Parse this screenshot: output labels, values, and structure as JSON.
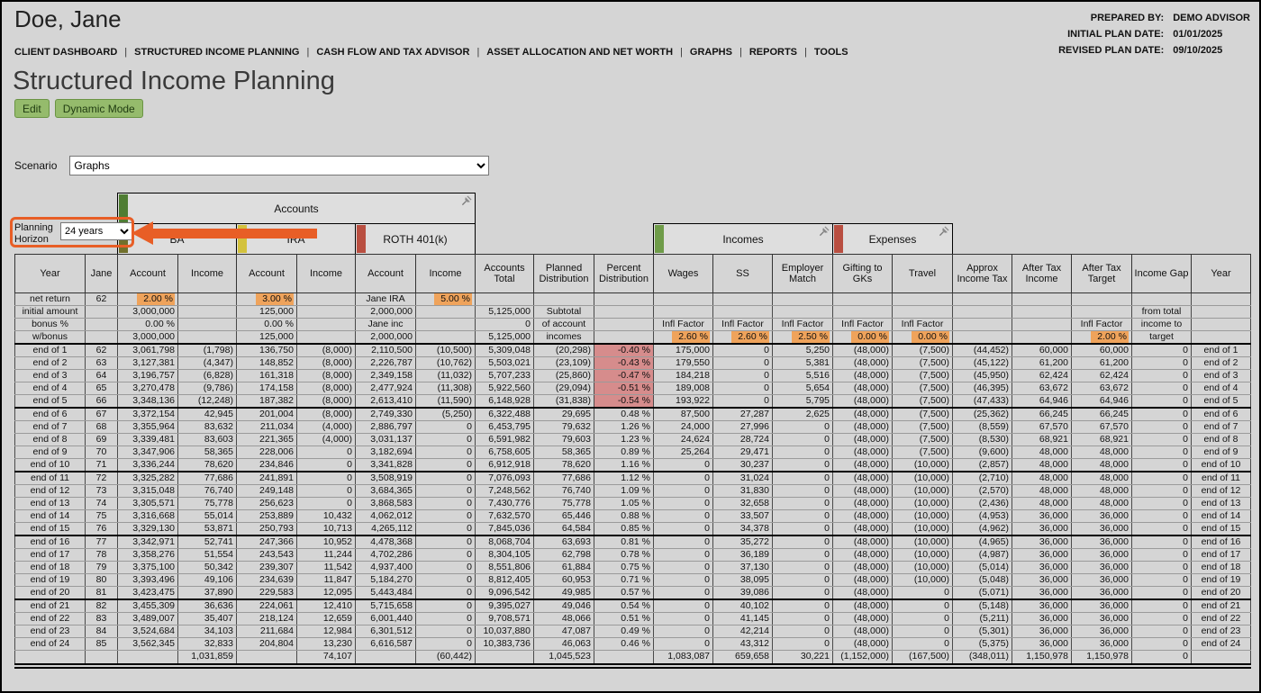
{
  "window": {
    "client_name": "Doe, Jane",
    "meta": [
      {
        "label": "PREPARED BY:",
        "value": "DEMO ADVISOR"
      },
      {
        "label": "INITIAL PLAN DATE:",
        "value": "01/01/2025"
      },
      {
        "label": "REVISED PLAN DATE:",
        "value": "09/10/2025"
      }
    ]
  },
  "nav": {
    "separator": "|",
    "items": [
      "CLIENT DASHBOARD",
      "STRUCTURED INCOME PLANNING",
      "CASH FLOW AND TAX ADVISOR",
      "ASSET ALLOCATION AND NET WORTH",
      "GRAPHS",
      "REPORTS",
      "TOOLS"
    ]
  },
  "page": {
    "title": "Structured Income Planning",
    "buttons": {
      "edit": "Edit",
      "dynamic_mode": "Dynamic Mode"
    }
  },
  "scenario": {
    "label": "Scenario",
    "value": "Graphs"
  },
  "planning_horizon": {
    "label": "Planning Horizon",
    "value": "24 years"
  },
  "colors": {
    "highlight_orange": "#efa35b",
    "highlight_red": "#d68c8c",
    "button_green": "#95bb6c",
    "button_green_border": "#6a9444",
    "annotation_orange": "#e85e26"
  },
  "groups": {
    "accounts": {
      "label": "Accounts",
      "color": "#4f7d33"
    },
    "ba": {
      "label": "BA",
      "color": "#71702c"
    },
    "ira": {
      "label": "IRA",
      "color": "#d3c23d"
    },
    "roth": {
      "label": "ROTH 401(k)",
      "color": "#b94f41"
    },
    "incomes": {
      "label": "Incomes",
      "color": "#6f9c49"
    },
    "expenses": {
      "label": "Expenses",
      "color": "#b94f41"
    }
  },
  "table": {
    "columns": [
      "Year",
      "Jane",
      "Account",
      "Income",
      "Account",
      "Income",
      "Account",
      "Income",
      "Accounts Total",
      "Planned Distribution",
      "Percent Distribution",
      "Wages",
      "SS",
      "Employer Match",
      "Gifting to GKs",
      "Travel",
      "Approx Income Tax",
      "After Tax Income",
      "After Tax Target",
      "Income Gap",
      "Year"
    ],
    "special_rows": [
      {
        "cells": [
          "net return",
          "62",
          {
            "t": "2.00 %",
            "hl": "o"
          },
          "",
          {
            "t": "3.00 %",
            "hl": "o"
          },
          "",
          {
            "t": "Jane IRA",
            "al": "c"
          },
          {
            "t": "5.00 %",
            "hl": "o"
          },
          "",
          "",
          "",
          "",
          "",
          "",
          "",
          "",
          "",
          "",
          "",
          "",
          ""
        ]
      },
      {
        "cells": [
          "initial amount",
          "",
          "3,000,000",
          "",
          "125,000",
          "",
          "2,000,000",
          "",
          "5,125,000",
          {
            "t": "Subtotal",
            "al": "c"
          },
          "",
          "",
          "",
          "",
          "",
          "",
          "",
          "",
          "",
          {
            "t": "from total",
            "al": "c"
          },
          ""
        ]
      },
      {
        "cells": [
          "bonus %",
          "",
          "0.00 %",
          "",
          "0.00 %",
          "",
          {
            "t": "Jane inc",
            "al": "c"
          },
          "",
          "0",
          {
            "t": "of account",
            "al": "c"
          },
          "",
          {
            "t": "Infl Factor",
            "al": "c"
          },
          {
            "t": "Infl Factor",
            "al": "c"
          },
          {
            "t": "Infl Factor",
            "al": "c"
          },
          {
            "t": "Infl Factor",
            "al": "c"
          },
          {
            "t": "Infl Factor",
            "al": "c"
          },
          "",
          "",
          {
            "t": "Infl Factor",
            "al": "c"
          },
          {
            "t": "income to",
            "al": "c"
          },
          ""
        ]
      },
      {
        "cells": [
          "w/bonus",
          "",
          "3,000,000",
          "",
          "125,000",
          "",
          "2,000,000",
          "",
          "5,125,000",
          {
            "t": "incomes",
            "al": "c"
          },
          "",
          {
            "t": "2.60 %",
            "hl": "o"
          },
          {
            "t": "2.60 %",
            "hl": "o"
          },
          {
            "t": "2.50 %",
            "hl": "o"
          },
          {
            "t": "0.00 %",
            "hl": "o"
          },
          {
            "t": "0.00 %",
            "hl": "o"
          },
          "",
          "",
          {
            "t": "2.00 %",
            "hl": "o"
          },
          {
            "t": "target",
            "al": "c"
          },
          ""
        ]
      }
    ],
    "rows": [
      [
        "end of 1",
        "62",
        "3,061,798",
        "(1,798)",
        "136,750",
        "(8,000)",
        "2,110,500",
        "(10,500)",
        "5,309,048",
        "(20,298)",
        {
          "t": "-0.40 %",
          "hl": "r"
        },
        "175,000",
        "0",
        "5,250",
        "(48,000)",
        "(7,500)",
        "(44,452)",
        "60,000",
        "60,000",
        "0",
        "end of 1"
      ],
      [
        "end of 2",
        "63",
        "3,127,381",
        "(4,347)",
        "148,852",
        "(8,000)",
        "2,226,787",
        "(10,762)",
        "5,503,021",
        "(23,109)",
        {
          "t": "-0.43 %",
          "hl": "r"
        },
        "179,550",
        "0",
        "5,381",
        "(48,000)",
        "(7,500)",
        "(45,122)",
        "61,200",
        "61,200",
        "0",
        "end of 2"
      ],
      [
        "end of 3",
        "64",
        "3,196,757",
        "(6,828)",
        "161,318",
        "(8,000)",
        "2,349,158",
        "(11,032)",
        "5,707,233",
        "(25,860)",
        {
          "t": "-0.47 %",
          "hl": "r"
        },
        "184,218",
        "0",
        "5,516",
        "(48,000)",
        "(7,500)",
        "(45,950)",
        "62,424",
        "62,424",
        "0",
        "end of 3"
      ],
      [
        "end of 4",
        "65",
        "3,270,478",
        "(9,786)",
        "174,158",
        "(8,000)",
        "2,477,924",
        "(11,308)",
        "5,922,560",
        "(29,094)",
        {
          "t": "-0.51 %",
          "hl": "r"
        },
        "189,008",
        "0",
        "5,654",
        "(48,000)",
        "(7,500)",
        "(46,395)",
        "63,672",
        "63,672",
        "0",
        "end of 4"
      ],
      [
        "end of 5",
        "66",
        "3,348,136",
        "(12,248)",
        "187,382",
        "(8,000)",
        "2,613,410",
        "(11,590)",
        "6,148,928",
        "(31,838)",
        {
          "t": "-0.54 %",
          "hl": "r"
        },
        "193,922",
        "0",
        "5,795",
        "(48,000)",
        "(7,500)",
        "(47,433)",
        "64,946",
        "64,946",
        "0",
        "end of 5"
      ],
      [
        "end of 6",
        "67",
        "3,372,154",
        "42,945",
        "201,004",
        "(8,000)",
        "2,749,330",
        "(5,250)",
        "6,322,488",
        "29,695",
        "0.48 %",
        "87,500",
        "27,287",
        "2,625",
        "(48,000)",
        "(7,500)",
        "(25,362)",
        "66,245",
        "66,245",
        "0",
        "end of 6"
      ],
      [
        "end of 7",
        "68",
        "3,355,964",
        "83,632",
        "211,034",
        "(4,000)",
        "2,886,797",
        "0",
        "6,453,795",
        "79,632",
        "1.26 %",
        "24,000",
        "27,996",
        "0",
        "(48,000)",
        "(7,500)",
        "(8,559)",
        "67,570",
        "67,570",
        "0",
        "end of 7"
      ],
      [
        "end of 8",
        "69",
        "3,339,481",
        "83,603",
        "221,365",
        "(4,000)",
        "3,031,137",
        "0",
        "6,591,982",
        "79,603",
        "1.23 %",
        "24,624",
        "28,724",
        "0",
        "(48,000)",
        "(7,500)",
        "(8,530)",
        "68,921",
        "68,921",
        "0",
        "end of 8"
      ],
      [
        "end of 9",
        "70",
        "3,347,906",
        "58,365",
        "228,006",
        "0",
        "3,182,694",
        "0",
        "6,758,605",
        "58,365",
        "0.89 %",
        "25,264",
        "29,471",
        "0",
        "(48,000)",
        "(7,500)",
        "(9,600)",
        "48,000",
        "48,000",
        "0",
        "end of 9"
      ],
      [
        "end of 10",
        "71",
        "3,336,244",
        "78,620",
        "234,846",
        "0",
        "3,341,828",
        "0",
        "6,912,918",
        "78,620",
        "1.16 %",
        "0",
        "30,237",
        "0",
        "(48,000)",
        "(10,000)",
        "(2,857)",
        "48,000",
        "48,000",
        "0",
        "end of 10"
      ],
      [
        "end of 11",
        "72",
        "3,325,282",
        "77,686",
        "241,891",
        "0",
        "3,508,919",
        "0",
        "7,076,093",
        "77,686",
        "1.12 %",
        "0",
        "31,024",
        "0",
        "(48,000)",
        "(10,000)",
        "(2,710)",
        "48,000",
        "48,000",
        "0",
        "end of 11"
      ],
      [
        "end of 12",
        "73",
        "3,315,048",
        "76,740",
        "249,148",
        "0",
        "3,684,365",
        "0",
        "7,248,562",
        "76,740",
        "1.09 %",
        "0",
        "31,830",
        "0",
        "(48,000)",
        "(10,000)",
        "(2,570)",
        "48,000",
        "48,000",
        "0",
        "end of 12"
      ],
      [
        "end of 13",
        "74",
        "3,305,571",
        "75,778",
        "256,623",
        "0",
        "3,868,583",
        "0",
        "7,430,776",
        "75,778",
        "1.05 %",
        "0",
        "32,658",
        "0",
        "(48,000)",
        "(10,000)",
        "(2,436)",
        "48,000",
        "48,000",
        "0",
        "end of 13"
      ],
      [
        "end of 14",
        "75",
        "3,316,668",
        "55,014",
        "253,889",
        "10,432",
        "4,062,012",
        "0",
        "7,632,570",
        "65,446",
        "0.88 %",
        "0",
        "33,507",
        "0",
        "(48,000)",
        "(10,000)",
        "(4,953)",
        "36,000",
        "36,000",
        "0",
        "end of 14"
      ],
      [
        "end of 15",
        "76",
        "3,329,130",
        "53,871",
        "250,793",
        "10,713",
        "4,265,112",
        "0",
        "7,845,036",
        "64,584",
        "0.85 %",
        "0",
        "34,378",
        "0",
        "(48,000)",
        "(10,000)",
        "(4,962)",
        "36,000",
        "36,000",
        "0",
        "end of 15"
      ],
      [
        "end of 16",
        "77",
        "3,342,971",
        "52,741",
        "247,366",
        "10,952",
        "4,478,368",
        "0",
        "8,068,704",
        "63,693",
        "0.81 %",
        "0",
        "35,272",
        "0",
        "(48,000)",
        "(10,000)",
        "(4,965)",
        "36,000",
        "36,000",
        "0",
        "end of 16"
      ],
      [
        "end of 17",
        "78",
        "3,358,276",
        "51,554",
        "243,543",
        "11,244",
        "4,702,286",
        "0",
        "8,304,105",
        "62,798",
        "0.78 %",
        "0",
        "36,189",
        "0",
        "(48,000)",
        "(10,000)",
        "(4,987)",
        "36,000",
        "36,000",
        "0",
        "end of 17"
      ],
      [
        "end of 18",
        "79",
        "3,375,100",
        "50,342",
        "239,307",
        "11,542",
        "4,937,400",
        "0",
        "8,551,806",
        "61,884",
        "0.75 %",
        "0",
        "37,130",
        "0",
        "(48,000)",
        "(10,000)",
        "(5,014)",
        "36,000",
        "36,000",
        "0",
        "end of 18"
      ],
      [
        "end of 19",
        "80",
        "3,393,496",
        "49,106",
        "234,639",
        "11,847",
        "5,184,270",
        "0",
        "8,812,405",
        "60,953",
        "0.71 %",
        "0",
        "38,095",
        "0",
        "(48,000)",
        "(10,000)",
        "(5,048)",
        "36,000",
        "36,000",
        "0",
        "end of 19"
      ],
      [
        "end of 20",
        "81",
        "3,423,475",
        "37,890",
        "229,583",
        "12,095",
        "5,443,484",
        "0",
        "9,096,542",
        "49,985",
        "0.57 %",
        "0",
        "39,086",
        "0",
        "(48,000)",
        "0",
        "(5,071)",
        "36,000",
        "36,000",
        "0",
        "end of 20"
      ],
      [
        "end of 21",
        "82",
        "3,455,309",
        "36,636",
        "224,061",
        "12,410",
        "5,715,658",
        "0",
        "9,395,027",
        "49,046",
        "0.54 %",
        "0",
        "40,102",
        "0",
        "(48,000)",
        "0",
        "(5,148)",
        "36,000",
        "36,000",
        "0",
        "end of 21"
      ],
      [
        "end of 22",
        "83",
        "3,489,007",
        "35,407",
        "218,124",
        "12,659",
        "6,001,440",
        "0",
        "9,708,571",
        "48,066",
        "0.51 %",
        "0",
        "41,145",
        "0",
        "(48,000)",
        "0",
        "(5,211)",
        "36,000",
        "36,000",
        "0",
        "end of 22"
      ],
      [
        "end of 23",
        "84",
        "3,524,684",
        "34,103",
        "211,684",
        "12,984",
        "6,301,512",
        "0",
        "10,037,880",
        "47,087",
        "0.49 %",
        "0",
        "42,214",
        "0",
        "(48,000)",
        "0",
        "(5,301)",
        "36,000",
        "36,000",
        "0",
        "end of 23"
      ],
      [
        "end of 24",
        "85",
        "3,562,345",
        "32,833",
        "204,804",
        "13,230",
        "6,616,587",
        "0",
        "10,383,736",
        "46,063",
        "0.46 %",
        "0",
        "43,312",
        "0",
        "(48,000)",
        "0",
        "(5,375)",
        "36,000",
        "36,000",
        "0",
        "end of 24"
      ]
    ],
    "totals": [
      "",
      "",
      "",
      "1,031,859",
      "",
      "74,107",
      "",
      "(60,442)",
      "",
      "1,045,523",
      "",
      "1,083,087",
      "659,658",
      "30,221",
      "(1,152,000)",
      "(167,500)",
      "(348,011)",
      "1,150,978",
      "1,150,978",
      "0",
      ""
    ]
  }
}
